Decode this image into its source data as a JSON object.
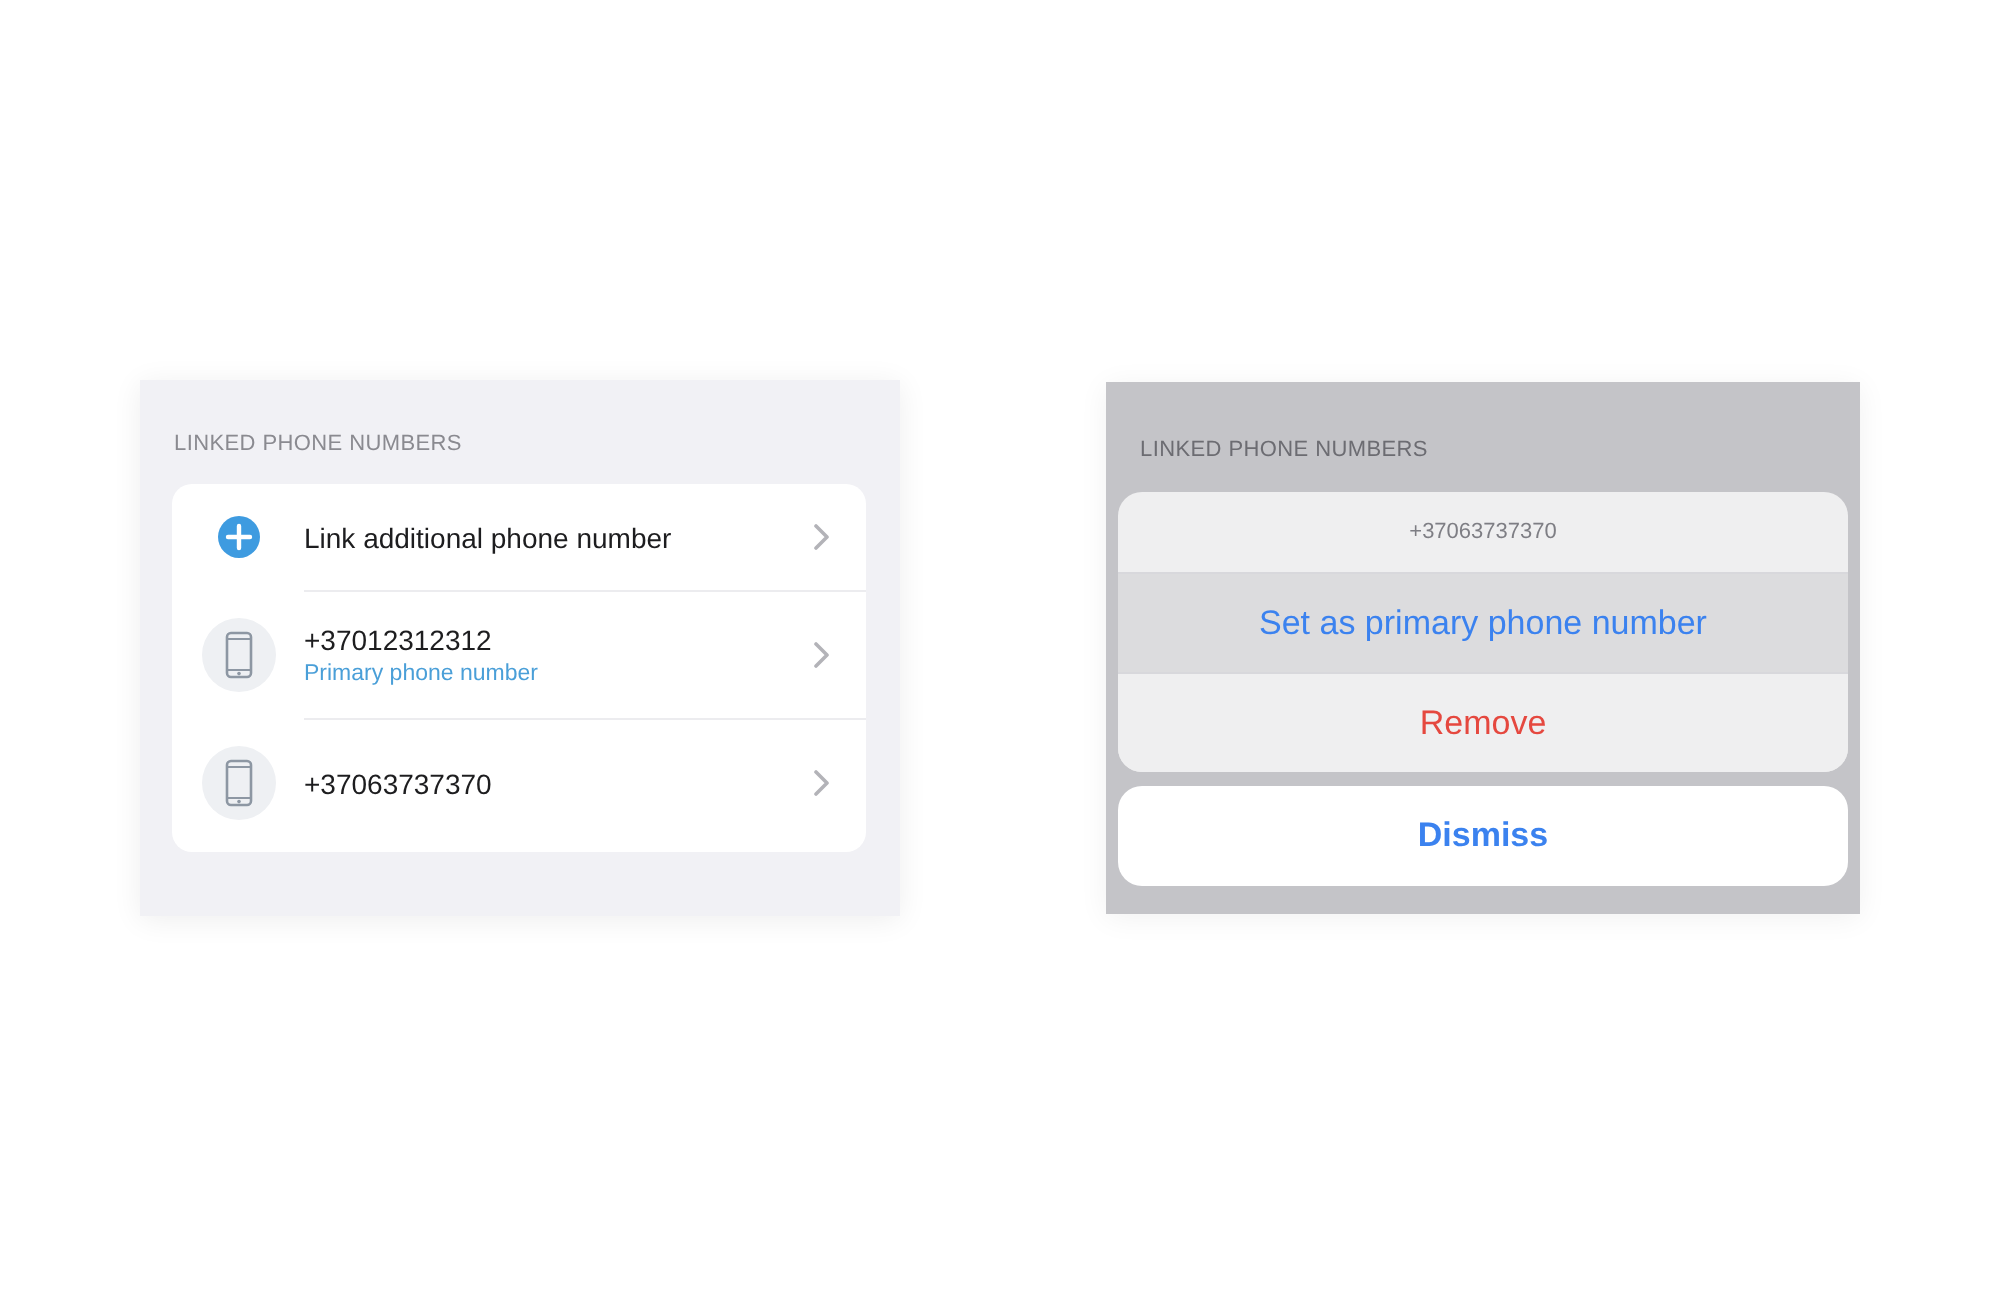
{
  "phone_list": {
    "header": "LINKED PHONE NUMBERS",
    "rows": [
      {
        "kind": "add",
        "title": "Link additional phone number"
      },
      {
        "kind": "phone",
        "title": "+37012312312",
        "subtitle": "Primary phone number"
      },
      {
        "kind": "phone",
        "title": "+37063737370"
      }
    ]
  },
  "action_sheet": {
    "header": "LINKED PHONE NUMBERS",
    "title": "+37063737370",
    "actions": [
      {
        "kind": "default",
        "label": "Set as primary phone number",
        "highlighted": true
      },
      {
        "kind": "destructive",
        "label": "Remove",
        "highlighted": false
      }
    ],
    "cancel": {
      "label": "Dismiss"
    }
  }
}
